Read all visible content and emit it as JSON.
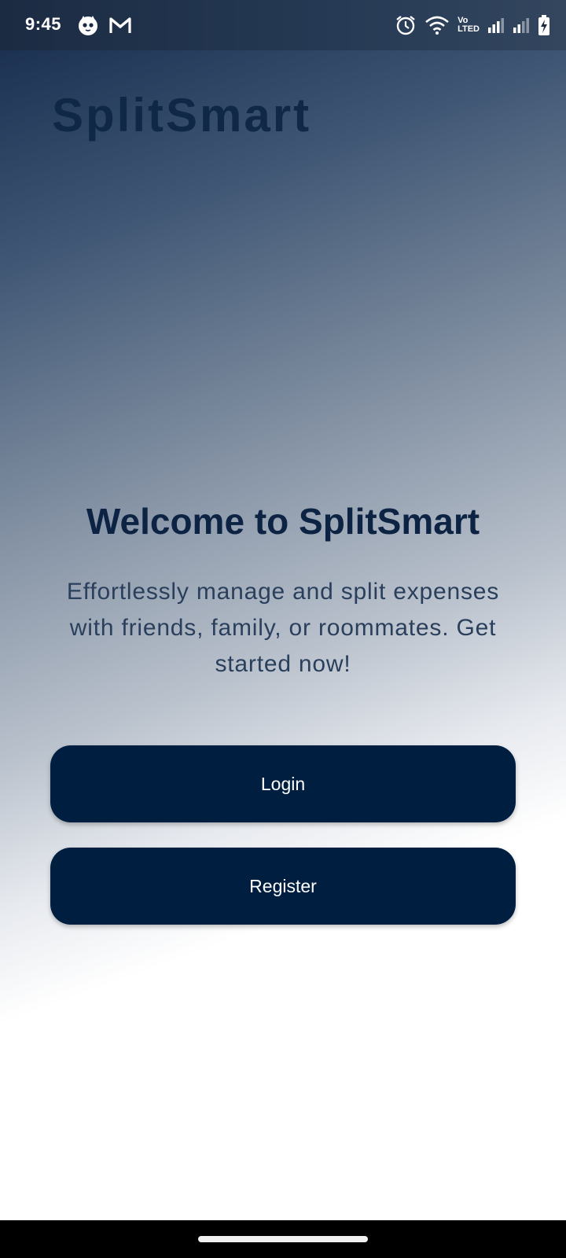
{
  "status_bar": {
    "time": "9:45",
    "left_icons": [
      "cat-face-icon",
      "gmail-icon"
    ],
    "right_icons": [
      "alarm-icon",
      "wifi-icon",
      "volte-icon",
      "signal-sim1-icon",
      "signal-sim2-icon",
      "battery-charging-icon"
    ],
    "volte_label_top": "Vo",
    "volte_label_bottom": "LTED"
  },
  "app": {
    "logo": "SplitSmart"
  },
  "welcome": {
    "title": "Welcome to SplitSmart",
    "text": "Effortlessly manage and split expenses with friends, family, or roommates. Get started now!"
  },
  "buttons": {
    "login_label": "Login",
    "register_label": "Register"
  },
  "colors": {
    "primary": "#001f40",
    "title": "#0d2343",
    "body_text": "#2a3f5c"
  }
}
